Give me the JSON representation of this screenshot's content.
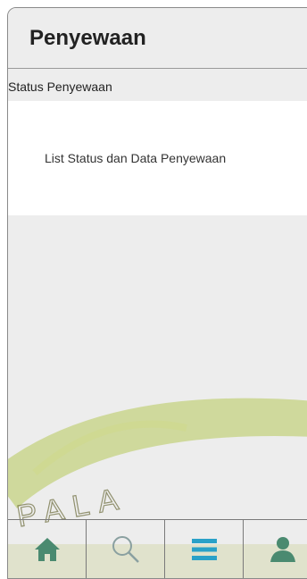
{
  "header": {
    "title": "Penyewaan"
  },
  "section": {
    "label": "Status Penyewaan"
  },
  "status_list": {
    "placeholder": "List Status dan Data Penyewaan"
  },
  "tabbar": {
    "items": [
      {
        "icon": "home-icon",
        "active": false
      },
      {
        "icon": "search-icon",
        "active": false
      },
      {
        "icon": "list-icon",
        "active": true
      },
      {
        "icon": "profile-icon",
        "active": false
      }
    ]
  },
  "watermark": {
    "text": "PALA"
  },
  "colors": {
    "accent": "#2aa1c8",
    "icon": "#4a8a70",
    "background": "#ededed"
  }
}
